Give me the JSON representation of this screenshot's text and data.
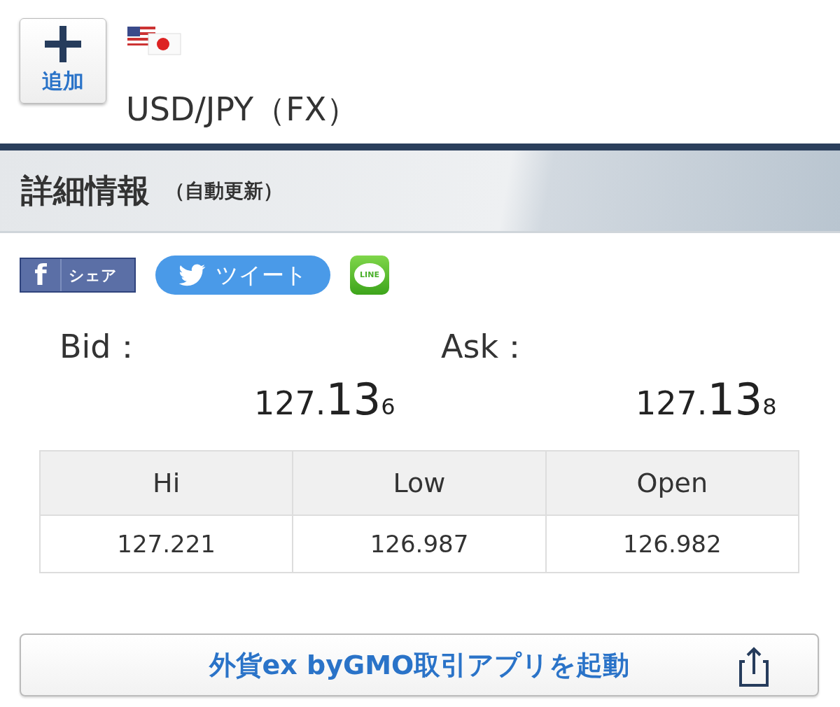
{
  "add_button": {
    "label": "追加"
  },
  "instrument": {
    "title": "USD/JPY（FX）"
  },
  "section": {
    "title": "詳細情報",
    "note": "（自動更新）"
  },
  "share": {
    "facebook": {
      "icon_text": "f",
      "label": "シェア"
    },
    "twitter": {
      "label": "ツイート"
    },
    "line": {
      "label": "LINE"
    }
  },
  "quotes": [
    {
      "label": "Bid：",
      "prefix": "127.",
      "big": "13",
      "suffix": "6"
    },
    {
      "label": "Ask：",
      "prefix": "127.",
      "big": "13",
      "suffix": "8"
    }
  ],
  "table": {
    "columns": [
      "Hi",
      "Low",
      "Open"
    ],
    "rows": [
      [
        "127.221",
        "126.987",
        "126.982"
      ]
    ]
  },
  "app_button": {
    "label": "外貨ex byGMO取引アプリを起動"
  }
}
